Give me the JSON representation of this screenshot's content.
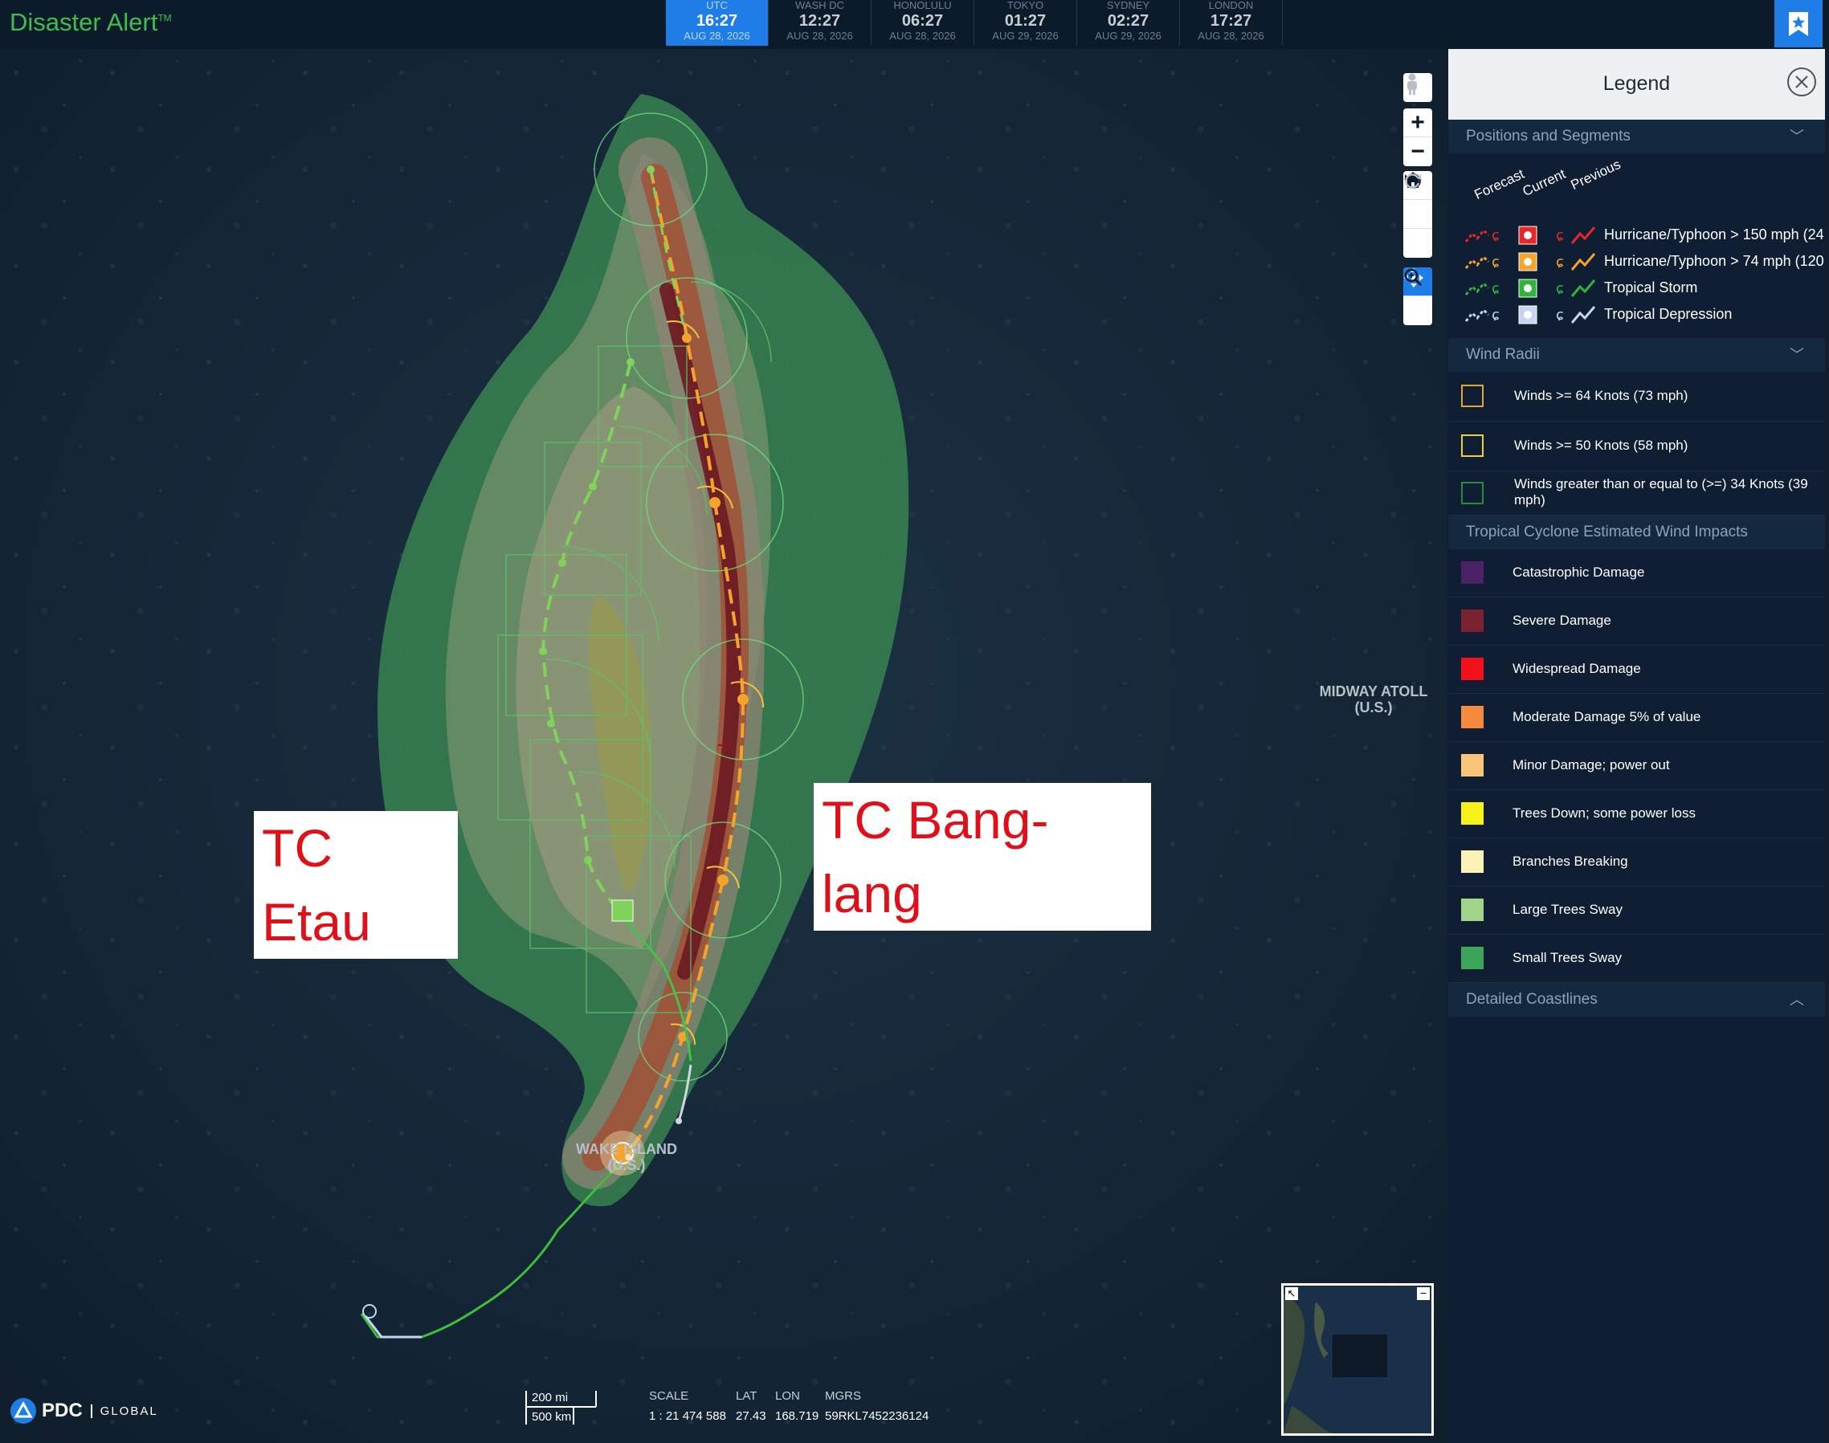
{
  "app": {
    "title": "Disaster Alert",
    "trademark": "TM"
  },
  "clocks": [
    {
      "zone": "UTC",
      "time": "16:27",
      "date": "AUG 28, 2026",
      "active": true
    },
    {
      "zone": "WASH DC",
      "time": "12:27",
      "date": "AUG 28, 2026",
      "active": false
    },
    {
      "zone": "HONOLULU",
      "time": "06:27",
      "date": "AUG 28, 2026",
      "active": false
    },
    {
      "zone": "TOKYO",
      "time": "01:27",
      "date": "AUG 29, 2026",
      "active": false
    },
    {
      "zone": "SYDNEY",
      "time": "02:27",
      "date": "AUG 29, 2026",
      "active": false
    },
    {
      "zone": "LONDON",
      "time": "17:27",
      "date": "AUG 28, 2026",
      "active": false
    }
  ],
  "map": {
    "labels": {
      "midway": "MIDWAY ATOLL",
      "midway_sub": "(U.S.)",
      "wake": "WAKE ISLAND",
      "wake_sub": "(U.S.)"
    },
    "callouts": {
      "etau": "TC Etau",
      "banglang": "TC Bang-lang"
    },
    "controls": [
      "pegman-icon",
      "zoom-in-icon",
      "zoom-out-icon",
      "home-icon",
      "rotate-left-icon",
      "rotate-right-icon",
      "pan-icon",
      "zoom-box-icon"
    ]
  },
  "legend": {
    "title": "Legend",
    "sections": {
      "positions": "Positions and Segments",
      "wind_radii": "Wind Radii",
      "impacts": "Tropical Cyclone Estimated Wind Impacts",
      "coastlines": "Detailed Coastlines"
    },
    "position_columns": [
      "Forecast",
      "Current",
      "Previous"
    ],
    "position_rows": [
      {
        "label": "Hurricane/Typhoon > 150 mph (24",
        "color": "#e8262a"
      },
      {
        "label": "Hurricane/Typhoon > 74 mph (120",
        "color": "#f5a32a"
      },
      {
        "label": "Tropical Storm",
        "color": "#2fb53c"
      },
      {
        "label": "Tropical Depression",
        "color": "#c9d4ee"
      }
    ],
    "wind_radii": [
      {
        "label": "Winds >= 64 Knots (73 mph)",
        "color": "#e9a52a"
      },
      {
        "label": "Winds >= 50 Knots (58 mph)",
        "color": "#e6d23a"
      },
      {
        "label": "Winds greater than or equal to (>=) 34 Knots (39 mph)",
        "color": "#2d8a3c"
      }
    ],
    "impacts": [
      {
        "label": "Catastrophic Damage",
        "color": "#4b2266"
      },
      {
        "label": "Severe Damage",
        "color": "#7a2230"
      },
      {
        "label": "Widespread Damage",
        "color": "#f2101a"
      },
      {
        "label": "Moderate Damage 5% of value",
        "color": "#f58a3c"
      },
      {
        "label": "Minor Damage; power out",
        "color": "#f7c57a"
      },
      {
        "label": "Trees Down; some power loss",
        "color": "#f7f21a"
      },
      {
        "label": "Branches Breaking",
        "color": "#fbf3b5"
      },
      {
        "label": "Large Trees Sway",
        "color": "#9fd48a"
      },
      {
        "label": "Small Trees Sway",
        "color": "#3ba65a"
      }
    ]
  },
  "footer": {
    "logo_text": "PDC",
    "logo_sub": "GLOBAL",
    "scale_mi": "200 mi",
    "scale_km": "500 km",
    "scale_label": "SCALE",
    "scale_value": "1 : 21 474 588",
    "lat_label": "LAT",
    "lat_value": "27.43",
    "lon_label": "LON",
    "lon_value": "168.719",
    "mgrs_label": "MGRS",
    "mgrs_value": "59RKL7452236124"
  }
}
